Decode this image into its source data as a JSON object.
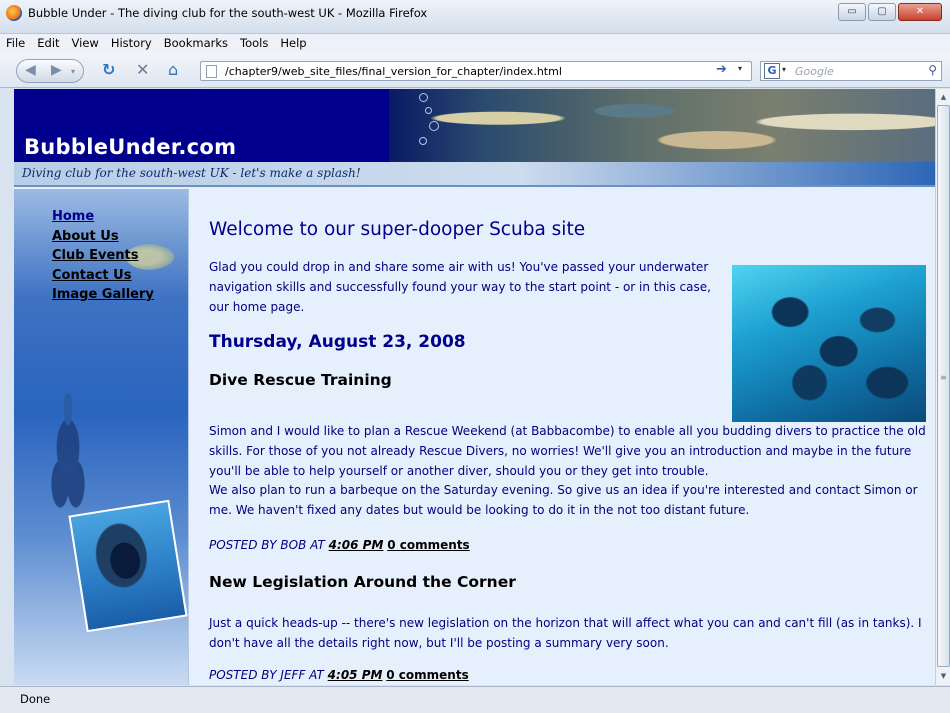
{
  "window": {
    "title": "Bubble Under - The diving club for the south-west UK - Mozilla Firefox",
    "buttons": {
      "minimize": "▭",
      "maximize": "▢",
      "close": "✕"
    }
  },
  "menu": [
    "File",
    "Edit",
    "View",
    "History",
    "Bookmarks",
    "Tools",
    "Help"
  ],
  "toolbar": {
    "url": "/chapter9/web_site_files/final_version_for_chapter/index.html",
    "search_placeholder": "Google",
    "icons": [
      "back-icon",
      "forward-icon",
      "reload-icon",
      "stop-icon",
      "home-icon",
      "go-icon",
      "search-icon"
    ]
  },
  "site": {
    "name": "BubbleUnder.com",
    "tagline": "Diving club for the south-west UK - let's make a splash!"
  },
  "nav": [
    {
      "label": "Home",
      "current": true
    },
    {
      "label": "About Us"
    },
    {
      "label": "Club Events"
    },
    {
      "label": "Contact Us"
    },
    {
      "label": "Image Gallery"
    }
  ],
  "main": {
    "heading": "Welcome to our super-dooper Scuba site",
    "intro": "Glad you could drop in and share some air with us! You've passed your underwater navigation skills and successfully found your way to the start point - or in this case, our home page.",
    "date": "Thursday, August 23, 2008",
    "posts": [
      {
        "title": "Dive Rescue Training",
        "body1": "Simon and I would like to plan a Rescue Weekend (at Babbacombe) to enable all you budding divers to practice the old skills. For those of you not already Rescue Divers, no worries! We'll give you an introduction and maybe in the future you'll be able to help yourself or another diver, should you or they get into trouble.",
        "body2": "We also plan to run a barbeque on the Saturday evening. So give us an idea if you're interested and contact Simon or me. We haven't fixed any dates but would be looking to do it in the not too distant future.",
        "meta_prefix": "POSTED BY BOB AT",
        "time": "4:06 PM",
        "comments": "0 comments"
      },
      {
        "title": "New Legislation Around the Corner",
        "body1": "Just a quick heads-up -- there's new legislation on the horizon that will affect what you can and can't fill (as in tanks). I don't have all the details right now, but I'll be posting a summary very soon.",
        "meta_prefix": "POSTED BY JEFF AT",
        "time": "4:05 PM",
        "comments": "0 comments"
      }
    ]
  },
  "status": "Done"
}
